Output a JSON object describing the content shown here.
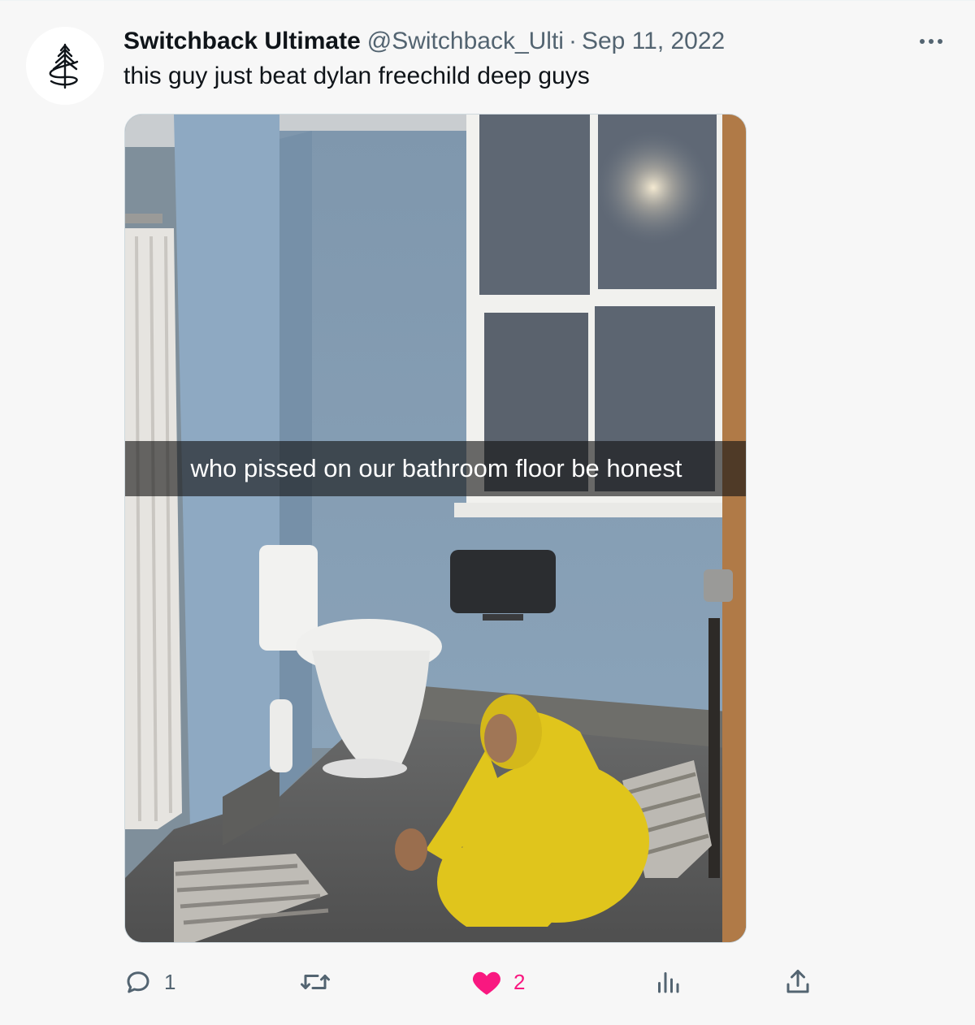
{
  "tweet": {
    "author_name": "Switchback Ultimate",
    "handle": "@Switchback_Ulti",
    "separator": "·",
    "date": "Sep 11, 2022",
    "text": "this guy just beat dylan freechild deep guys"
  },
  "media": {
    "caption": "who pissed on our bathroom floor be honest",
    "icon": "tweet-photo"
  },
  "actions": {
    "reply": {
      "icon": "reply-icon",
      "count": "1"
    },
    "retweet": {
      "icon": "retweet-icon",
      "count": ""
    },
    "like": {
      "icon": "heart-icon",
      "count": "2",
      "active": true,
      "color": "#f91880"
    },
    "views": {
      "icon": "analytics-icon",
      "count": ""
    },
    "share": {
      "icon": "share-icon"
    }
  },
  "colors": {
    "text_primary": "#0f1419",
    "text_secondary": "#536471",
    "like_accent": "#f91880",
    "background": "#f7f7f7"
  }
}
